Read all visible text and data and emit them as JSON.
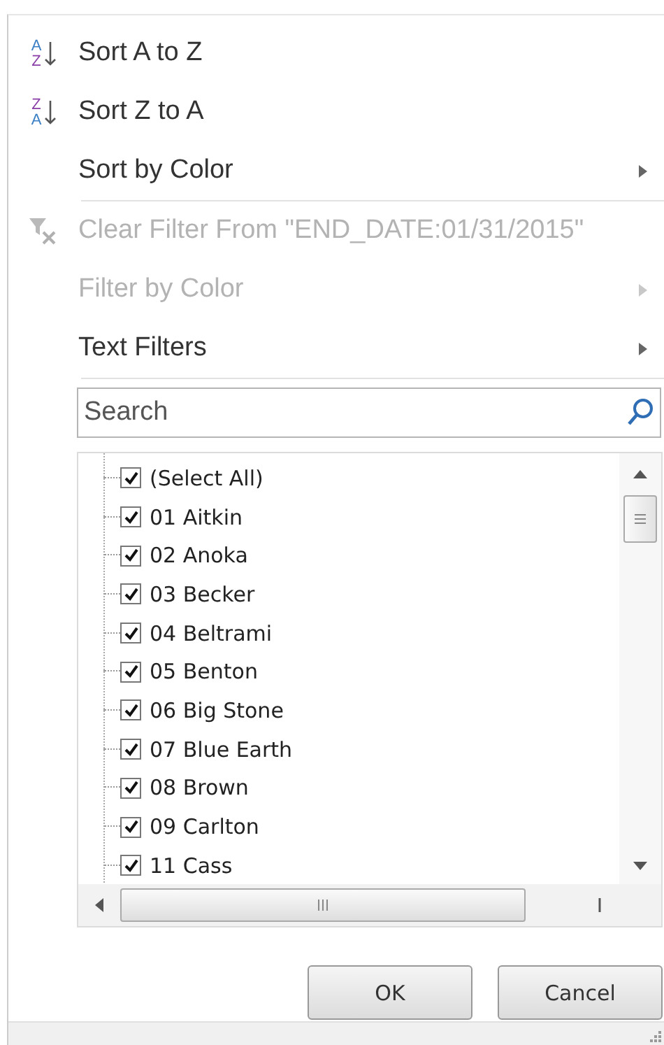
{
  "menu": [
    {
      "label": "Sort A to Z",
      "kind": "sort",
      "icon_letters": [
        "A",
        "Z"
      ],
      "disabled": false,
      "submenu": false,
      "separator_after": false
    },
    {
      "label": "Sort Z to A",
      "kind": "sort",
      "icon_letters": [
        "Z",
        "A"
      ],
      "disabled": false,
      "submenu": false,
      "separator_after": false
    },
    {
      "label": "Sort by Color",
      "kind": "plain",
      "disabled": false,
      "submenu": true,
      "separator_after": true
    },
    {
      "label": "Clear Filter From \"END_DATE:01/31/2015\"",
      "kind": "clear_filter",
      "disabled": true,
      "submenu": false,
      "separator_after": false
    },
    {
      "label": "Filter by Color",
      "kind": "plain",
      "disabled": true,
      "submenu": true,
      "separator_after": false
    },
    {
      "label": "Text Filters",
      "kind": "plain",
      "disabled": false,
      "submenu": true,
      "separator_after": true
    }
  ],
  "search": {
    "placeholder": "Search"
  },
  "items": [
    {
      "label": "(Select All)",
      "checked": true
    },
    {
      "label": "01 Aitkin",
      "checked": true
    },
    {
      "label": "02 Anoka",
      "checked": true
    },
    {
      "label": "03 Becker",
      "checked": true
    },
    {
      "label": "04 Beltrami",
      "checked": true
    },
    {
      "label": "05 Benton",
      "checked": true
    },
    {
      "label": "06 Big Stone",
      "checked": true
    },
    {
      "label": "07 Blue Earth",
      "checked": true
    },
    {
      "label": "08 Brown",
      "checked": true
    },
    {
      "label": "09 Carlton",
      "checked": true
    },
    {
      "label": "11 Cass",
      "checked": true
    }
  ],
  "buttons": [
    {
      "label": "OK"
    },
    {
      "label": "Cancel"
    }
  ]
}
